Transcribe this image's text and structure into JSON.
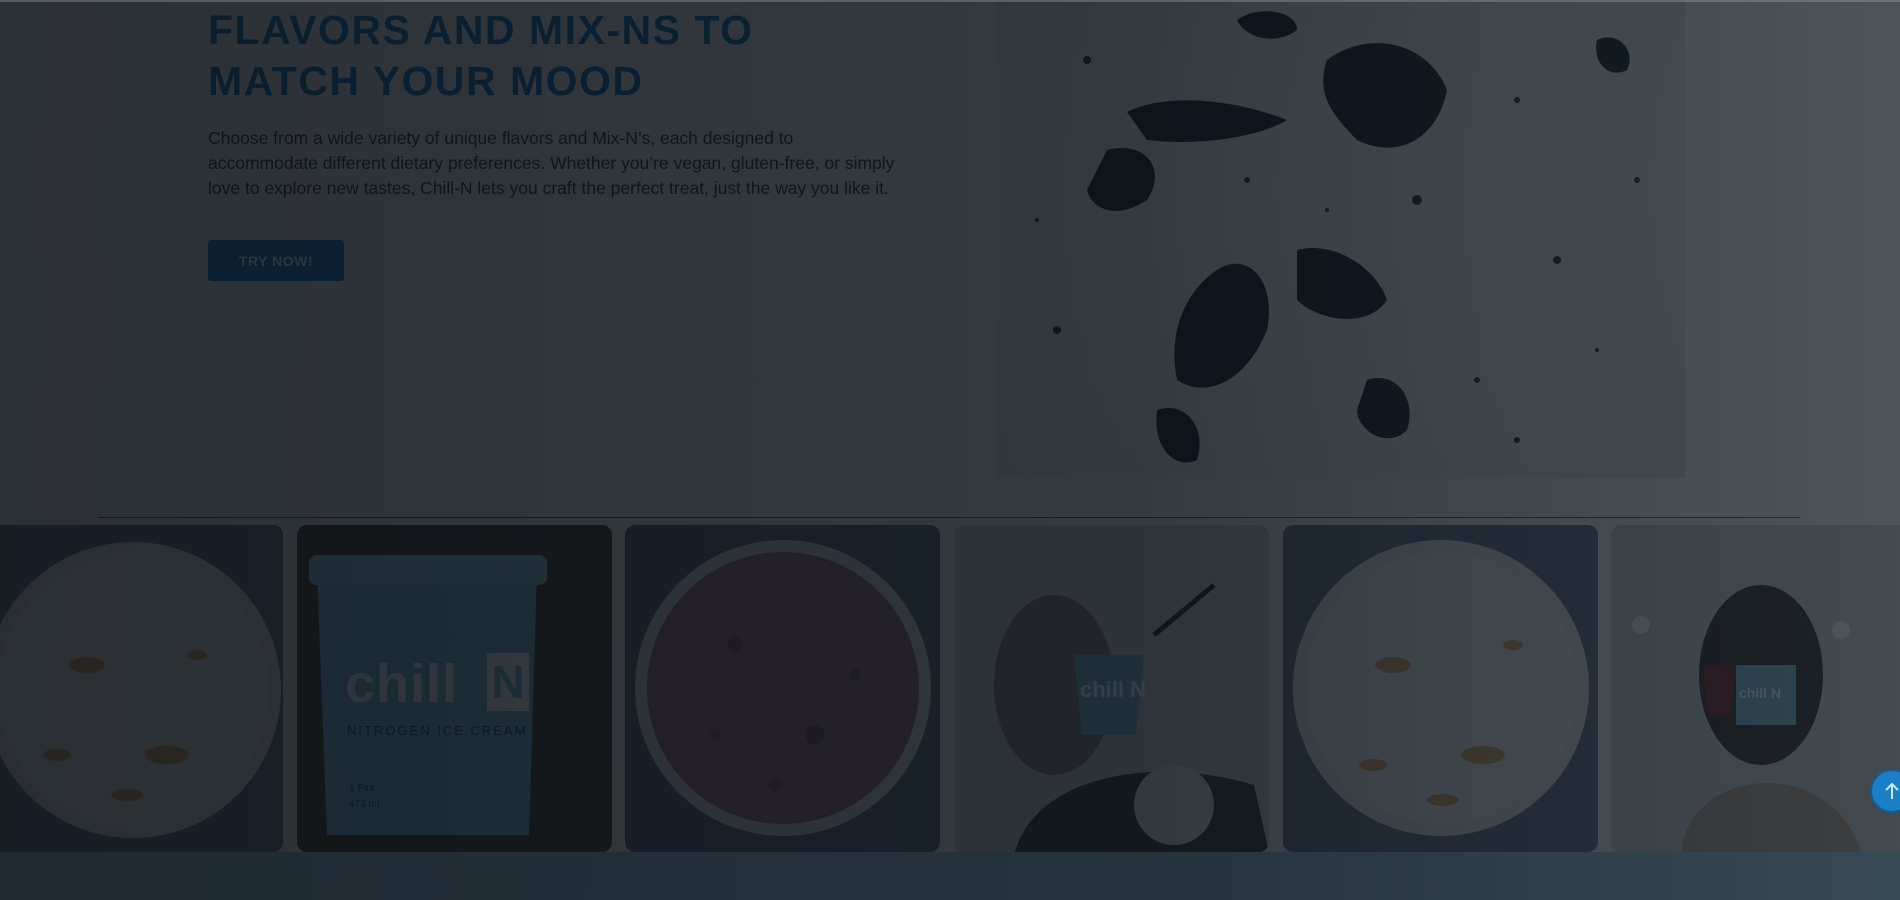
{
  "hero": {
    "title": "FLAVORS AND MIX-NS TO MATCH YOUR MOOD",
    "body": "Choose from a wide variety of unique flavors and Mix-N’s, each designed to accommodate different dietary preferences. Whether you’re vegan, gluten-free, or simply love to explore new tastes, Chill-N lets you craft the perfect treat, just the way you like it.",
    "cta_label": "TRY NOW!",
    "image_label": "cookies-and-cream-ice-cream-image"
  },
  "gallery": {
    "tiles": [
      {
        "name": "gallery-tile-caramel-cup-partial",
        "kind": "cup-vanilla"
      },
      {
        "name": "gallery-tile-pint",
        "kind": "pint",
        "brand": "chill",
        "brand_badge": "N",
        "subtitle": "NITROGEN ICE CREAM",
        "size_line_1": "1 Pint",
        "size_line_2": "473 mL"
      },
      {
        "name": "gallery-tile-chocolate-cup",
        "kind": "cup-chocolate"
      },
      {
        "name": "gallery-tile-person-eating",
        "kind": "person-eating",
        "cup_text": "chill N"
      },
      {
        "name": "gallery-tile-caramel-cup",
        "kind": "cup-vanilla"
      },
      {
        "name": "gallery-tile-person-with-wine",
        "kind": "person-wine",
        "cup_text": "chill N"
      }
    ]
  },
  "colors": {
    "accent": "#0b79c4",
    "title_blue": "#0b6fb2",
    "overlay": "#0a1016"
  },
  "icons": {
    "scroll_top": "arrow-up-icon"
  }
}
